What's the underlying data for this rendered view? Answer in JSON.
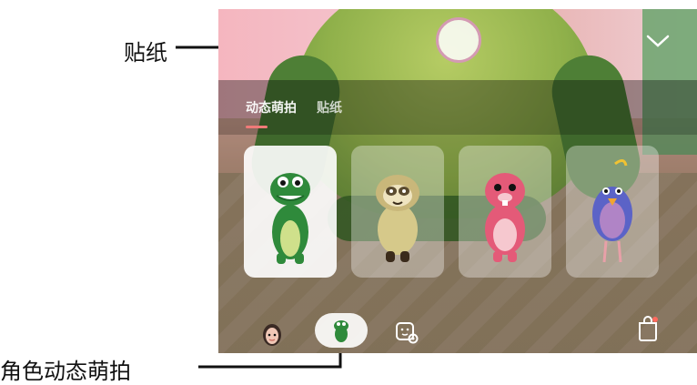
{
  "annotations": {
    "sticker_label": "贴纸",
    "ar_label": "角色动态萌拍"
  },
  "ui": {
    "tabs": [
      {
        "label": "动态萌拍",
        "active": true
      },
      {
        "label": "贴纸",
        "active": false
      }
    ],
    "accent_color": "#f07a78",
    "characters": [
      {
        "name": "dinosaur",
        "selected": true
      },
      {
        "name": "sloth",
        "selected": false
      },
      {
        "name": "pink-beaver",
        "selected": false
      },
      {
        "name": "blue-bird",
        "selected": false
      }
    ],
    "bottom_icons": [
      "avatar-icon",
      "ar-character-icon",
      "sticker-settings-icon",
      "store-bag-icon"
    ]
  }
}
